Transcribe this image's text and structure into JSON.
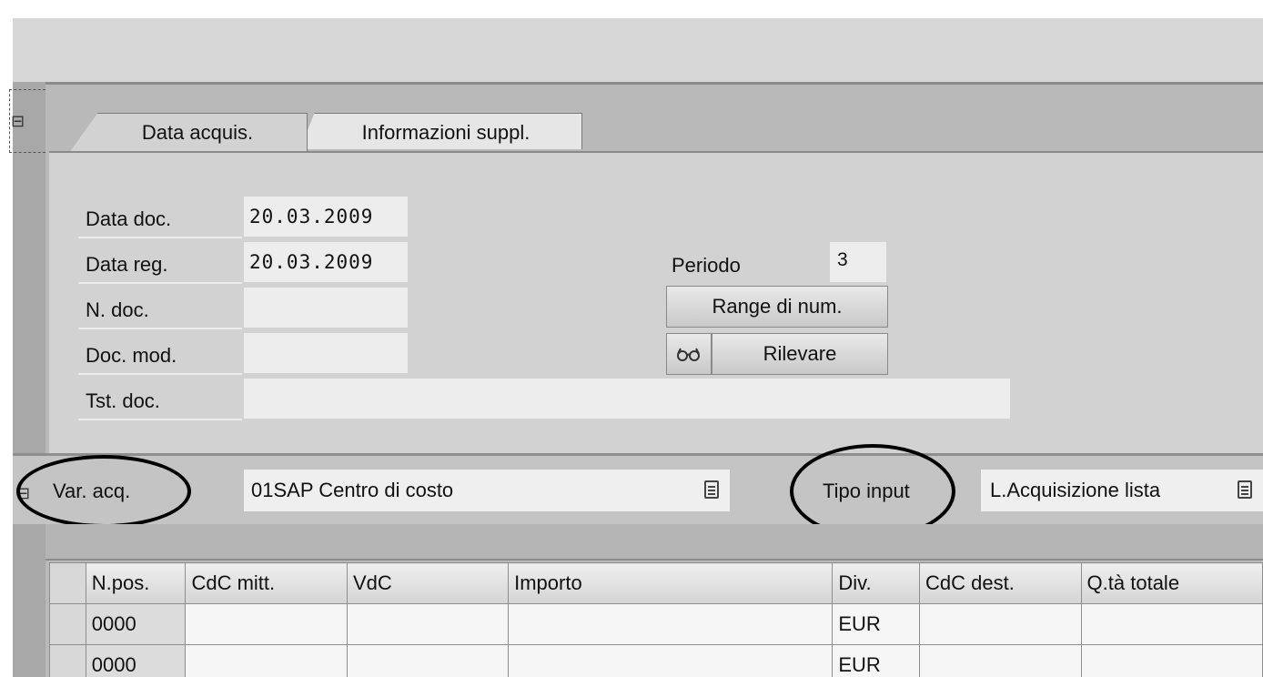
{
  "tabs": [
    {
      "label": "Data acquis.",
      "active": true
    },
    {
      "label": "Informazioni suppl.",
      "active": false
    }
  ],
  "header_fields": {
    "data_doc": {
      "label": "Data doc.",
      "value": "20.03.2009"
    },
    "data_reg": {
      "label": "Data reg.",
      "value": "20.03.2009"
    },
    "n_doc": {
      "label": "N. doc.",
      "value": ""
    },
    "doc_mod": {
      "label": "Doc. mod.",
      "value": ""
    },
    "tst_doc": {
      "label": "Tst. doc.",
      "value": ""
    }
  },
  "periodo": {
    "label": "Periodo",
    "value": "3"
  },
  "buttons": {
    "range": "Range di num.",
    "rilevare": "Rilevare",
    "rilevare_icon": "glasses-icon"
  },
  "variant": {
    "label": "Var. acq.",
    "value": "01SAP Centro di costo"
  },
  "input_type": {
    "label": "Tipo input",
    "value": "L.Acquisizione lista"
  },
  "grid": {
    "columns": [
      "N.pos.",
      "CdC mitt.",
      "VdC",
      "Importo",
      "Div.",
      "CdC dest.",
      "Q.tà totale"
    ],
    "rows": [
      [
        "0000",
        "",
        "",
        "",
        "EUR",
        "",
        ""
      ],
      [
        "0000",
        "",
        "",
        "",
        "EUR",
        "",
        ""
      ]
    ]
  },
  "annotations": [
    "circle around Var. acq.",
    "circle around Tipo input"
  ]
}
